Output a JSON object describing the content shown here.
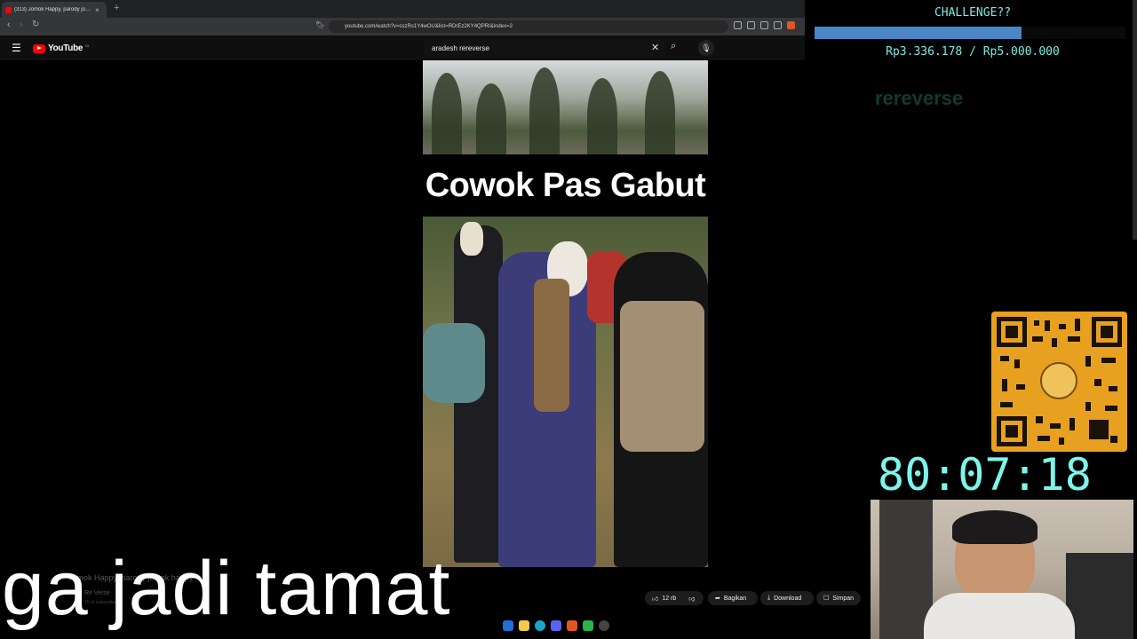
{
  "browser": {
    "tab_title": "(313) Jomok Happy, parody jomok happy",
    "url": "youtube.com/watch?v=cszRs1Y4wOU&list=RDrEz2KY4QPRI&index=2"
  },
  "youtube": {
    "logo_text": "YouTube",
    "logo_country": "ID",
    "search_value": "aradesh rereverse",
    "video_caption": "Cowok Pas Gabut",
    "video_title": "Jomok Happy, parody jomok happy",
    "channel_name": "Re Verse",
    "subscribers": "15 rb subscriber",
    "actions": {
      "likes": "12 rb",
      "share_label": "Bagikan",
      "download_label": "Download",
      "save_label": "Simpan"
    }
  },
  "subtitle_overlay": "ga jadi tamat",
  "stream_overlay": {
    "challenge_label": "CHALLENGE??",
    "amount_text": "Rp3.336.178 / Rp5.000.000",
    "progress": 0.667,
    "ghost_text": "rereverse",
    "timer": "80:07:18"
  },
  "colors": {
    "overlay_text": "#7de8e0",
    "progress_fill": "#4a86c6",
    "qr_background": "#e8a020",
    "youtube_red": "#ff0000"
  }
}
